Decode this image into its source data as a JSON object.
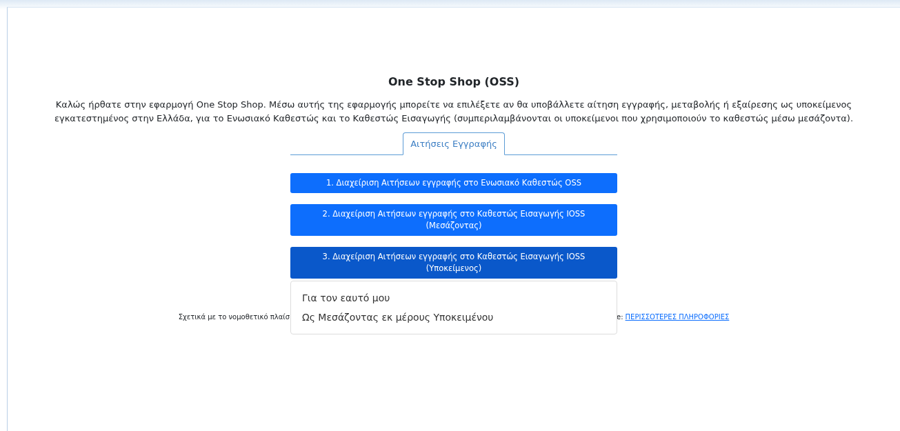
{
  "title": "One Stop Shop (OSS)",
  "intro": "Καλώς ήρθατε στην εφαρμογή One Stop Shop. Μέσω αυτής της εφαρμογής μπορείτε να επιλέξετε αν θα υποβάλλετε αίτηση εγγραφής, μεταβολής ή εξαίρεσης ως υποκείμενος εγκατεστημένος στην Ελλάδα, για το Ενωσιακό Καθεστώς και το Καθεστώς Εισαγωγής (συμπεριλαμβάνονται οι υποκείμενοι που χρησιμοποιούν το καθεστώς μέσω μεσάζοντα).",
  "tabs": [
    {
      "label": "Αιτήσεις Εγγραφής",
      "selected": true
    }
  ],
  "buttons": [
    {
      "label": "1. Διαχείριση Αιτήσεων εγγραφής στο Ενωσιακό Καθεστώς OSS",
      "expanded": false
    },
    {
      "label": "2. Διαχείριση Αιτήσεων εγγραφής στο Καθεστώς Εισαγωγής IOSS (Μεσάζοντας)",
      "expanded": false
    },
    {
      "label": "3. Διαχείριση Αιτήσεων εγγραφής στο Καθεστώς Εισαγωγής IOSS (Υποκείμενος)",
      "expanded": true,
      "menu": [
        "Για τον εαυτό μου",
        "Ως Μεσάζοντας εκ μέρους Υποκειμένου"
      ]
    }
  ],
  "footer": {
    "left": "Σχετικά με το νομοθετικό πλαίσ",
    "right": "e:",
    "link": "ΠΕΡΙΣΣΟΤΕΡΕΣ ΠΛΗΡΟΦΟΡΙΕΣ"
  }
}
